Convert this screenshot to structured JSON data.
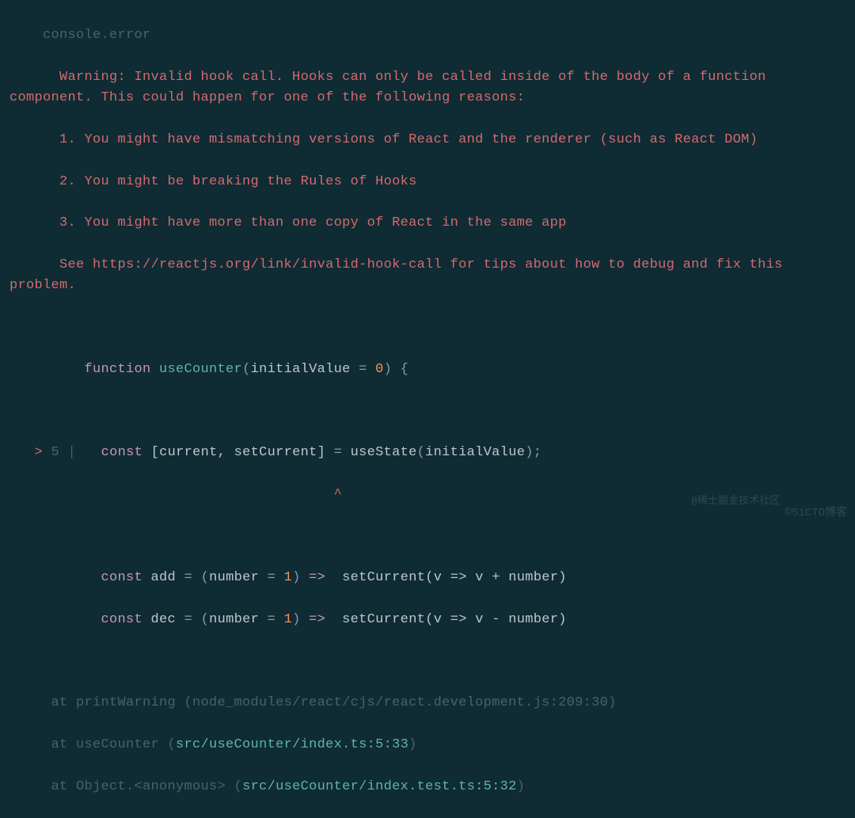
{
  "error": {
    "prefix": "    console.error",
    "lines": [
      "      Warning: Invalid hook call. Hooks can only be called inside of the body of a function component. This could happen for one of the following reasons:",
      "      1. You might have mismatching versions of React and the renderer (such as React DOM)",
      "      2. You might be breaking the Rules of Hooks",
      "      3. You might have more than one copy of React in the same app",
      "      See https://reactjs.org/link/invalid-hook-call for tips about how to debug and fix this problem."
    ]
  },
  "code": {
    "line1": {
      "indent": "         ",
      "kw": "function",
      "name": " useCounter",
      "open": "(",
      "param": "initialValue",
      "eq": " = ",
      "num": "0",
      "close": ") {"
    },
    "arrow": {
      "prefix": "   > ",
      "gutter": "5 |",
      "indent": "   ",
      "kw": "const",
      "destruct": " [current, setCurrent] ",
      "eq": "= ",
      "call": "useState",
      "open": "(",
      "arg": "initialValue",
      "close": ");"
    },
    "caret": "                                       ^",
    "add": {
      "indent": "           ",
      "kw": "const",
      "name": " add ",
      "eq": "= ",
      "open": "(",
      "param": "number",
      "peq": " = ",
      "num": "1",
      "close": ") ",
      "arrow": "=>",
      "body": "  setCurrent(v => v + number)"
    },
    "dec": {
      "indent": "           ",
      "kw": "const",
      "name": " dec ",
      "eq": "= ",
      "open": "(",
      "param": "number",
      "peq": " = ",
      "num": "1",
      "close": ") ",
      "arrow": "=>",
      "body": "  setCurrent(v => v - number)"
    }
  },
  "stack": {
    "l1": {
      "at": "     at printWarning (",
      "path": "node_modules/react/cjs/react.development.js:209:30",
      "close": ")"
    },
    "l2": {
      "at": "     at useCounter (",
      "path": "src/useCounter/index.ts:5:33",
      "close": ")"
    },
    "l3": {
      "at": "     at Object.<anonymous> (",
      "path": "src/useCounter/index.test.ts:5:32",
      "close": ")"
    }
  },
  "watermark1": "@稀土掘金技术社区",
  "watermark2": "©51CTO博客"
}
